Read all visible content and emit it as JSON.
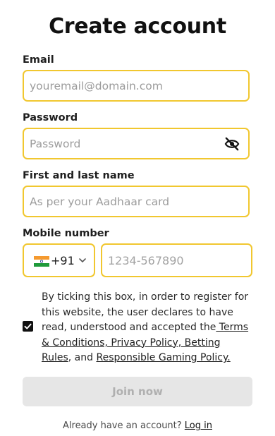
{
  "page": {
    "title": "Create account"
  },
  "form": {
    "email": {
      "label": "Email",
      "placeholder": "youremail@domain.com"
    },
    "password": {
      "label": "Password",
      "placeholder": "Password",
      "toggle_icon": "eye-slash-icon"
    },
    "name": {
      "label": "First and last name",
      "placeholder": "As per your Aadhaar card"
    },
    "mobile": {
      "label": "Mobile number",
      "country_code": "+91",
      "flag_icon": "india-flag-icon",
      "placeholder": "1234-567890"
    }
  },
  "consent": {
    "checked": true,
    "text_before": "By ticking this box, in order to register for this website, the user declares to have read, understood and accepted the",
    "link_terms": " Terms & Conditions, Privacy Policy, Betting Rules",
    "text_and": ", and ",
    "link_rgp": "Responsible Gaming Policy."
  },
  "actions": {
    "join_label": "Join now"
  },
  "footer": {
    "prompt": "Already have an account? ",
    "login_label": "Log in"
  },
  "colors": {
    "field_border": "#f1c72f",
    "button_disabled_bg": "#e6e6e6",
    "button_disabled_text": "#b0b0b0"
  }
}
